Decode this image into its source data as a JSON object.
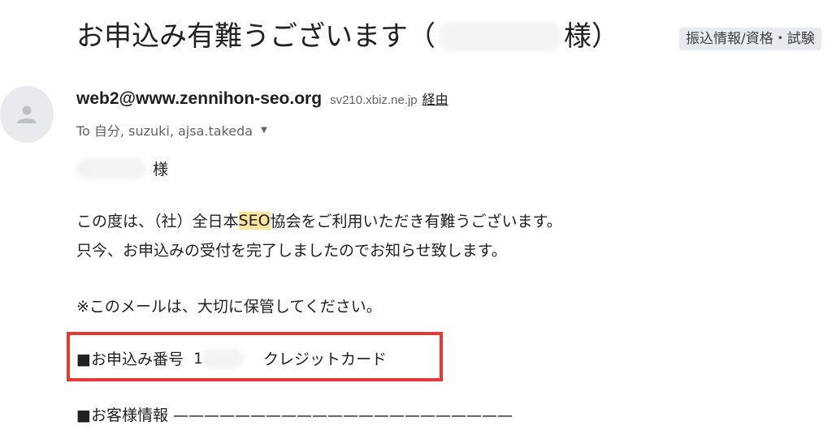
{
  "email": {
    "subject_prefix": "お申込み有難うございます（",
    "subject_suffix": "様）",
    "label": "振込情報/資格・試験",
    "sender": {
      "name": "web2@www.zennihon-seo.org",
      "via_host": "sv210.xbiz.ne.jp",
      "via_label": "経由"
    },
    "recipients": "To 自分, suzuki, ajsa.takeda",
    "body": {
      "salutation_suffix": "様",
      "line1_pre": "この度は、（社）全日本",
      "line1_hl": "SEO",
      "line1_post": "協会をご利用いただき有難うございます。",
      "line2": "只今、お申込みの受付を完了しましたのでお知らせ致します。",
      "line3": "※このメールは、大切に保管してください。",
      "application_label": "■お申込み番号",
      "application_number_prefix": "1",
      "payment_method": "クレジットカード",
      "customer_info": "■お客様情報 ——————————————————————"
    }
  },
  "colors": {
    "highlight": "#fbe59d",
    "annotation_box": "#e53935",
    "label_chip_bg": "#e8eaed"
  },
  "icons": {
    "avatar": "person-icon",
    "recipients_toggle": "caret-down-icon"
  }
}
